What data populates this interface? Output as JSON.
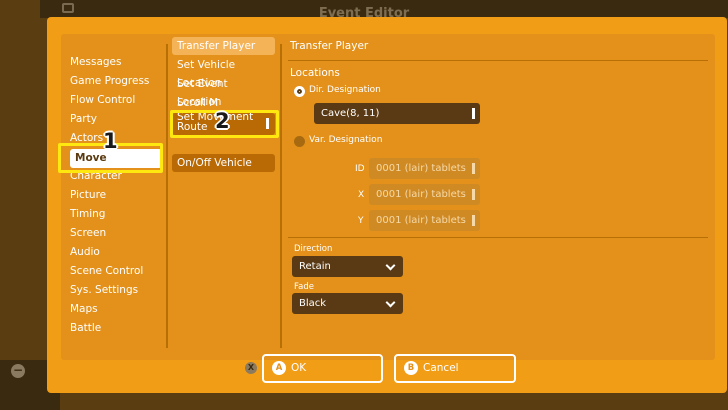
{
  "window": {
    "title": "Event Editor"
  },
  "categories": [
    {
      "label": "Messages"
    },
    {
      "label": "Game Progress"
    },
    {
      "label": "Flow Control"
    },
    {
      "label": "Party"
    },
    {
      "label": "Actors"
    },
    {
      "label": "Move"
    },
    {
      "label": "Character"
    },
    {
      "label": "Picture"
    },
    {
      "label": "Timing"
    },
    {
      "label": "Screen"
    },
    {
      "label": "Audio"
    },
    {
      "label": "Scene Control"
    },
    {
      "label": "Sys. Settings"
    },
    {
      "label": "Maps"
    },
    {
      "label": "Battle"
    }
  ],
  "selected_category": "Move",
  "commands": [
    {
      "label": "Transfer Player"
    },
    {
      "label": "Set Vehicle Location"
    },
    {
      "label": "Set Event Location"
    },
    {
      "label": "Scroll M"
    },
    {
      "label": "Set Movement",
      "label2": "Route"
    },
    {
      "label": "On/Off Vehicle"
    }
  ],
  "annotations": {
    "badge1": "1",
    "badge2": "2"
  },
  "detail": {
    "title": "Transfer Player",
    "locations_label": "Locations",
    "dir_label": "Dir. Designation",
    "dir_value": "Cave(8, 11)",
    "var_label": "Var. Designation",
    "var_fields": [
      {
        "axis": "ID",
        "value": "0001 (lair) tablets"
      },
      {
        "axis": "X",
        "value": "0001 (lair) tablets"
      },
      {
        "axis": "Y",
        "value": "0001 (lair) tablets"
      }
    ],
    "direction_label": "Direction",
    "direction_value": "Retain",
    "fade_label": "Fade",
    "fade_value": "Black"
  },
  "buttons": {
    "x_glyph": "X",
    "ok_glyph": "A",
    "ok_label": "OK",
    "cancel_glyph": "B",
    "cancel_label": "Cancel"
  },
  "background": {
    "minus_glyph": "−"
  },
  "colors": {
    "dialog": "#f29d16",
    "panel": "#e3911a",
    "highlight": "#ffe810",
    "field_dark": "#5a3a14"
  }
}
